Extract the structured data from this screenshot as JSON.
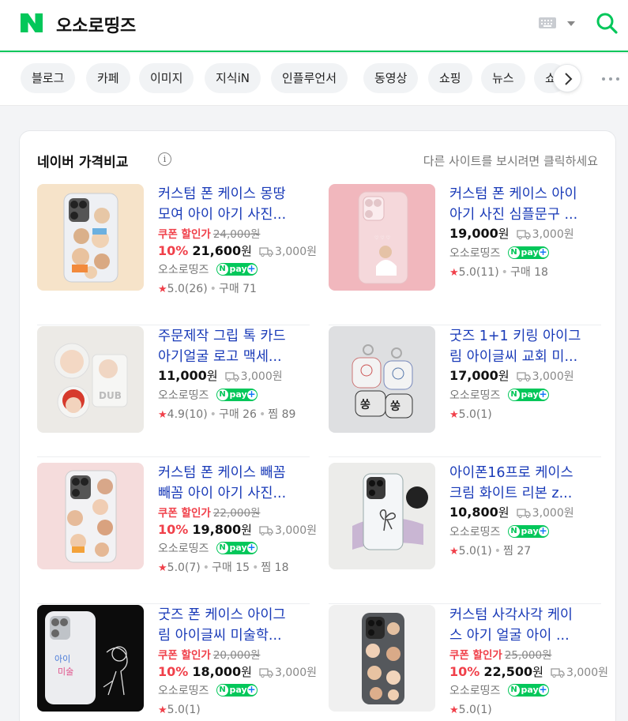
{
  "header": {
    "query": "오소로띵즈"
  },
  "tabs": [
    "블로그",
    "카페",
    "이미지",
    "지식iN",
    "인플루언서",
    "동영상",
    "쇼핑",
    "뉴스",
    "쇼"
  ],
  "section": {
    "title": "네이버 가격비교",
    "link": "다른 사이트를 보시려면 클릭하세요"
  },
  "products": [
    {
      "title1": "커스텀 폰 케이스 몽땅",
      "title2": "모여 아이 아기 사진...",
      "coupon": "쿠폰 할인가",
      "orig": "24,000원",
      "discount": "10%",
      "price": "21,600",
      "won": "원",
      "shipping": "3,000원",
      "seller": "오소로띵즈",
      "rating": "5.0(26)",
      "stats": [
        "구매 71"
      ]
    },
    {
      "title1": "커스텀 폰 케이스 아이",
      "title2": "아기 사진 심플문구 ...",
      "price": "19,000",
      "won": "원",
      "shipping": "3,000원",
      "seller": "오소로띵즈",
      "rating": "5.0(11)",
      "stats": [
        "구매 18"
      ]
    },
    {
      "title1": "주문제작 그립 톡 카드",
      "title2": "아기얼굴 로고 맥세...",
      "price": "11,000",
      "won": "원",
      "shipping": "3,000원",
      "seller": "오소로띵즈",
      "rating": "4.9(10)",
      "stats": [
        "구매 26",
        "찜 89"
      ]
    },
    {
      "title1": "굿즈 1+1 키링 아이그",
      "title2": "림 아이글씨 교회 미...",
      "price": "17,000",
      "won": "원",
      "shipping": "3,000원",
      "seller": "오소로띵즈",
      "rating": "5.0(1)",
      "stats": []
    },
    {
      "title1": "커스텀 폰 케이스 빼꼼",
      "title2": "빼꼼 아이 아기 사진...",
      "coupon": "쿠폰 할인가",
      "orig": "22,000원",
      "discount": "10%",
      "price": "19,800",
      "won": "원",
      "shipping": "3,000원",
      "seller": "오소로띵즈",
      "rating": "5.0(7)",
      "stats": [
        "구매 15",
        "찜 18"
      ]
    },
    {
      "title1": "아이폰16프로 케이스",
      "title2": "크림 화이트 리본 z...",
      "price": "10,800",
      "won": "원",
      "shipping": "3,000원",
      "seller": "오소로띵즈",
      "rating": "5.0(1)",
      "stats": [
        "찜 27"
      ]
    },
    {
      "title1": "굿즈 폰 케이스 아이그",
      "title2": "림 아이글씨 미술학...",
      "coupon": "쿠폰 할인가",
      "orig": "20,000원",
      "discount": "10%",
      "price": "18,000",
      "won": "원",
      "shipping": "3,000원",
      "seller": "오소로띵즈",
      "rating": "5.0(1)",
      "stats": []
    },
    {
      "title1": "커스텀 사각사각 케이",
      "title2": "스 아기 얼굴 아이 ...",
      "coupon": "쿠폰 할인가",
      "orig": "25,000원",
      "discount": "10%",
      "price": "22,500",
      "won": "원",
      "shipping": "3,000원",
      "seller": "오소로띵즈",
      "rating": "5.0(1)",
      "stats": []
    }
  ],
  "npay": {
    "n": "N",
    "label": "pay",
    "plus": "+"
  },
  "star": "★",
  "colors": {
    "brand": "#03c75a",
    "link": "#1a3bb8",
    "discount": "#f0404a"
  }
}
